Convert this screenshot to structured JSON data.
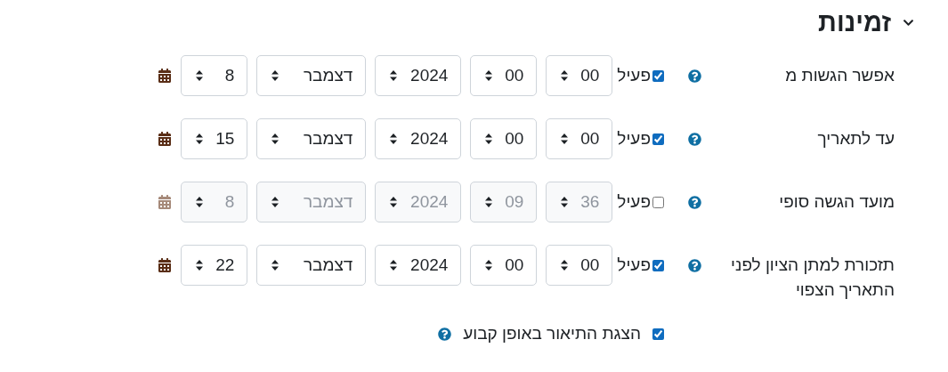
{
  "section": {
    "title": "זמינות",
    "expanded": true
  },
  "rows": [
    {
      "label": "אפשר הגשות מ",
      "enable_label": "פעיל",
      "enabled": true,
      "fields": [
        {
          "kind": "minute",
          "value": "00"
        },
        {
          "kind": "hour",
          "value": "00"
        },
        {
          "kind": "year",
          "value": "2024"
        },
        {
          "kind": "month",
          "value": "דצמבר"
        },
        {
          "kind": "day",
          "value": "8"
        }
      ]
    },
    {
      "label": "עד לתאריך",
      "enable_label": "פעיל",
      "enabled": true,
      "fields": [
        {
          "kind": "minute",
          "value": "00"
        },
        {
          "kind": "hour",
          "value": "00"
        },
        {
          "kind": "year",
          "value": "2024"
        },
        {
          "kind": "month",
          "value": "דצמבר"
        },
        {
          "kind": "day",
          "value": "15"
        }
      ]
    },
    {
      "label": "מועד הגשה סופי",
      "enable_label": "פעיל",
      "enabled": false,
      "fields": [
        {
          "kind": "minute",
          "value": "36"
        },
        {
          "kind": "hour",
          "value": "09"
        },
        {
          "kind": "year",
          "value": "2024"
        },
        {
          "kind": "month",
          "value": "דצמבר"
        },
        {
          "kind": "day",
          "value": "8"
        }
      ]
    },
    {
      "label": "תזכורת למתן הציון לפני התאריך הצפוי",
      "enable_label": "פעיל",
      "enabled": true,
      "fields": [
        {
          "kind": "minute",
          "value": "00"
        },
        {
          "kind": "hour",
          "value": "00"
        },
        {
          "kind": "year",
          "value": "2024"
        },
        {
          "kind": "month",
          "value": "דצמבר"
        },
        {
          "kind": "day",
          "value": "22"
        }
      ]
    }
  ],
  "always_show_description": {
    "label": "הצגת התיאור באופן קבוע",
    "checked": true
  }
}
